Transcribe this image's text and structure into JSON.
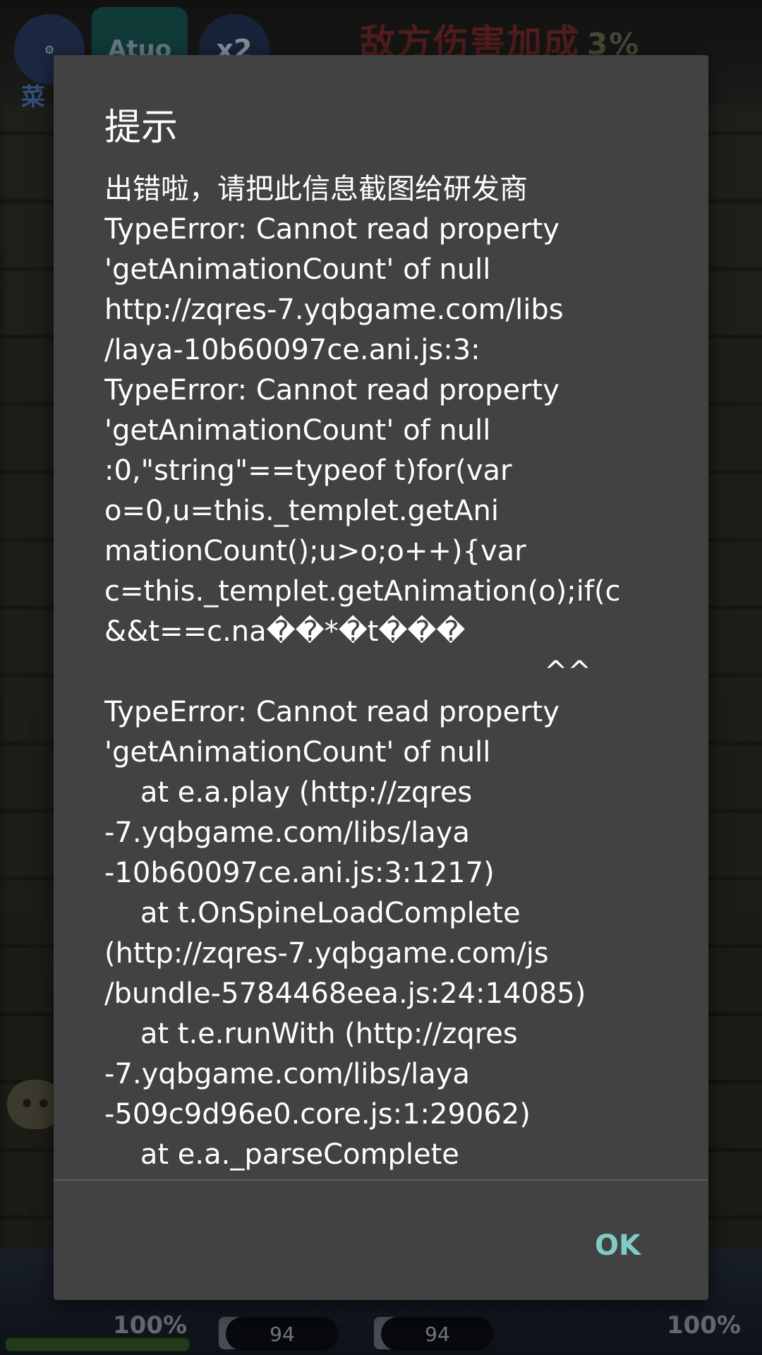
{
  "game": {
    "menu_label": "菜",
    "auto_label": "Atuo",
    "speed_label": "x2",
    "banner_text": "敌方伤害加成",
    "banner_value": "3%",
    "left_percent": "100%",
    "right_percent": "100%",
    "stat_a": "94",
    "stat_b": "94"
  },
  "dialog": {
    "title": "提示",
    "message_lines": [
      "出错啦，请把此信息截图给研发商",
      "TypeError: Cannot read property",
      "'getAnimationCount' of null",
      "http://zqres-7.yqbgame.com/libs",
      "/laya-10b60097ce.ani.js:3:",
      "TypeError: Cannot read property",
      "'getAnimationCount' of null",
      ":0,\"string\"==typeof t)for(var",
      "o=0,u=this._templet.getAni",
      "mationCount();u>o;o++){var",
      "c=this._templet.getAnimation(o);if(c",
      "&&t==c.na��*�t���",
      "                                                 ^^",
      "TypeError: Cannot read property",
      "'getAnimationCount' of null",
      "    at e.a.play (http://zqres",
      "-7.yqbgame.com/libs/laya",
      "-10b60097ce.ani.js:3:1217)",
      "    at t.OnSpineLoadComplete",
      "(http://zqres-7.yqbgame.com/js",
      "/bundle-5784468eea.js:24:14085)",
      "    at t.e.runWith (http://zqres",
      "-7.yqbgame.com/libs/laya",
      "-509c9d96e0.core.js:1:29062)",
      "    at e.a._parseComplete"
    ],
    "ok_label": "OK"
  }
}
